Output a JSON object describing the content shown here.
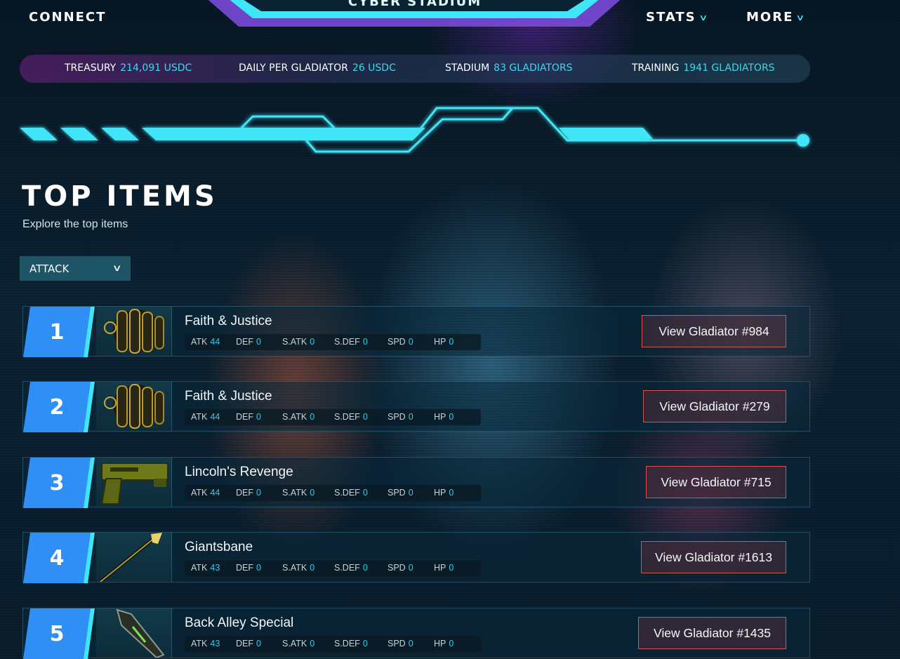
{
  "nav": {
    "connect": "CONNECT",
    "stadium_title": "CYBER STADIUM",
    "stats": "STATS",
    "more": "MORE"
  },
  "stats_bar": {
    "treasury_label": "TREASURY",
    "treasury_value": "214,091 USDC",
    "daily_label": "DAILY PER GLADIATOR",
    "daily_value": "26 USDC",
    "stadium_label": "STADIUM",
    "stadium_value": "83 GLADIATORS",
    "training_label": "TRAINING",
    "training_value": "1941 GLADIATORS"
  },
  "heading": {
    "title": "TOP ITEMS",
    "subtitle": "Explore the top items"
  },
  "filter": {
    "selected": "ATTACK"
  },
  "stat_labels": {
    "atk": "ATK",
    "def": "DEF",
    "satk": "S.ATK",
    "sdef": "S.DEF",
    "spd": "SPD",
    "hp": "HP"
  },
  "items": [
    {
      "rank": "1",
      "name": "Faith & Justice",
      "image": "gauntlet-icon",
      "atk": "44",
      "def": "0",
      "satk": "0",
      "sdef": "0",
      "spd": "0",
      "hp": "0",
      "button": "View Gladiator #984"
    },
    {
      "rank": "2",
      "name": "Faith & Justice",
      "image": "gauntlet-icon",
      "atk": "44",
      "def": "0",
      "satk": "0",
      "sdef": "0",
      "spd": "0",
      "hp": "0",
      "button": "View Gladiator #279"
    },
    {
      "rank": "3",
      "name": "Lincoln's Revenge",
      "image": "pistol-icon",
      "atk": "44",
      "def": "0",
      "satk": "0",
      "sdef": "0",
      "spd": "0",
      "hp": "0",
      "button": "View Gladiator #715"
    },
    {
      "rank": "4",
      "name": "Giantsbane",
      "image": "spear-icon",
      "atk": "43",
      "def": "0",
      "satk": "0",
      "sdef": "0",
      "spd": "0",
      "hp": "0",
      "button": "View Gladiator #1613"
    },
    {
      "rank": "5",
      "name": "Back Alley Special",
      "image": "blade-icon",
      "atk": "43",
      "def": "0",
      "satk": "0",
      "sdef": "0",
      "spd": "0",
      "hp": "0",
      "button": "View Gladiator #1435"
    }
  ],
  "colors": {
    "accent": "#3fe6f8",
    "rank_blue": "#2f8ff5",
    "button_border": "#d9524f",
    "stat_value": "#39d9f0"
  }
}
